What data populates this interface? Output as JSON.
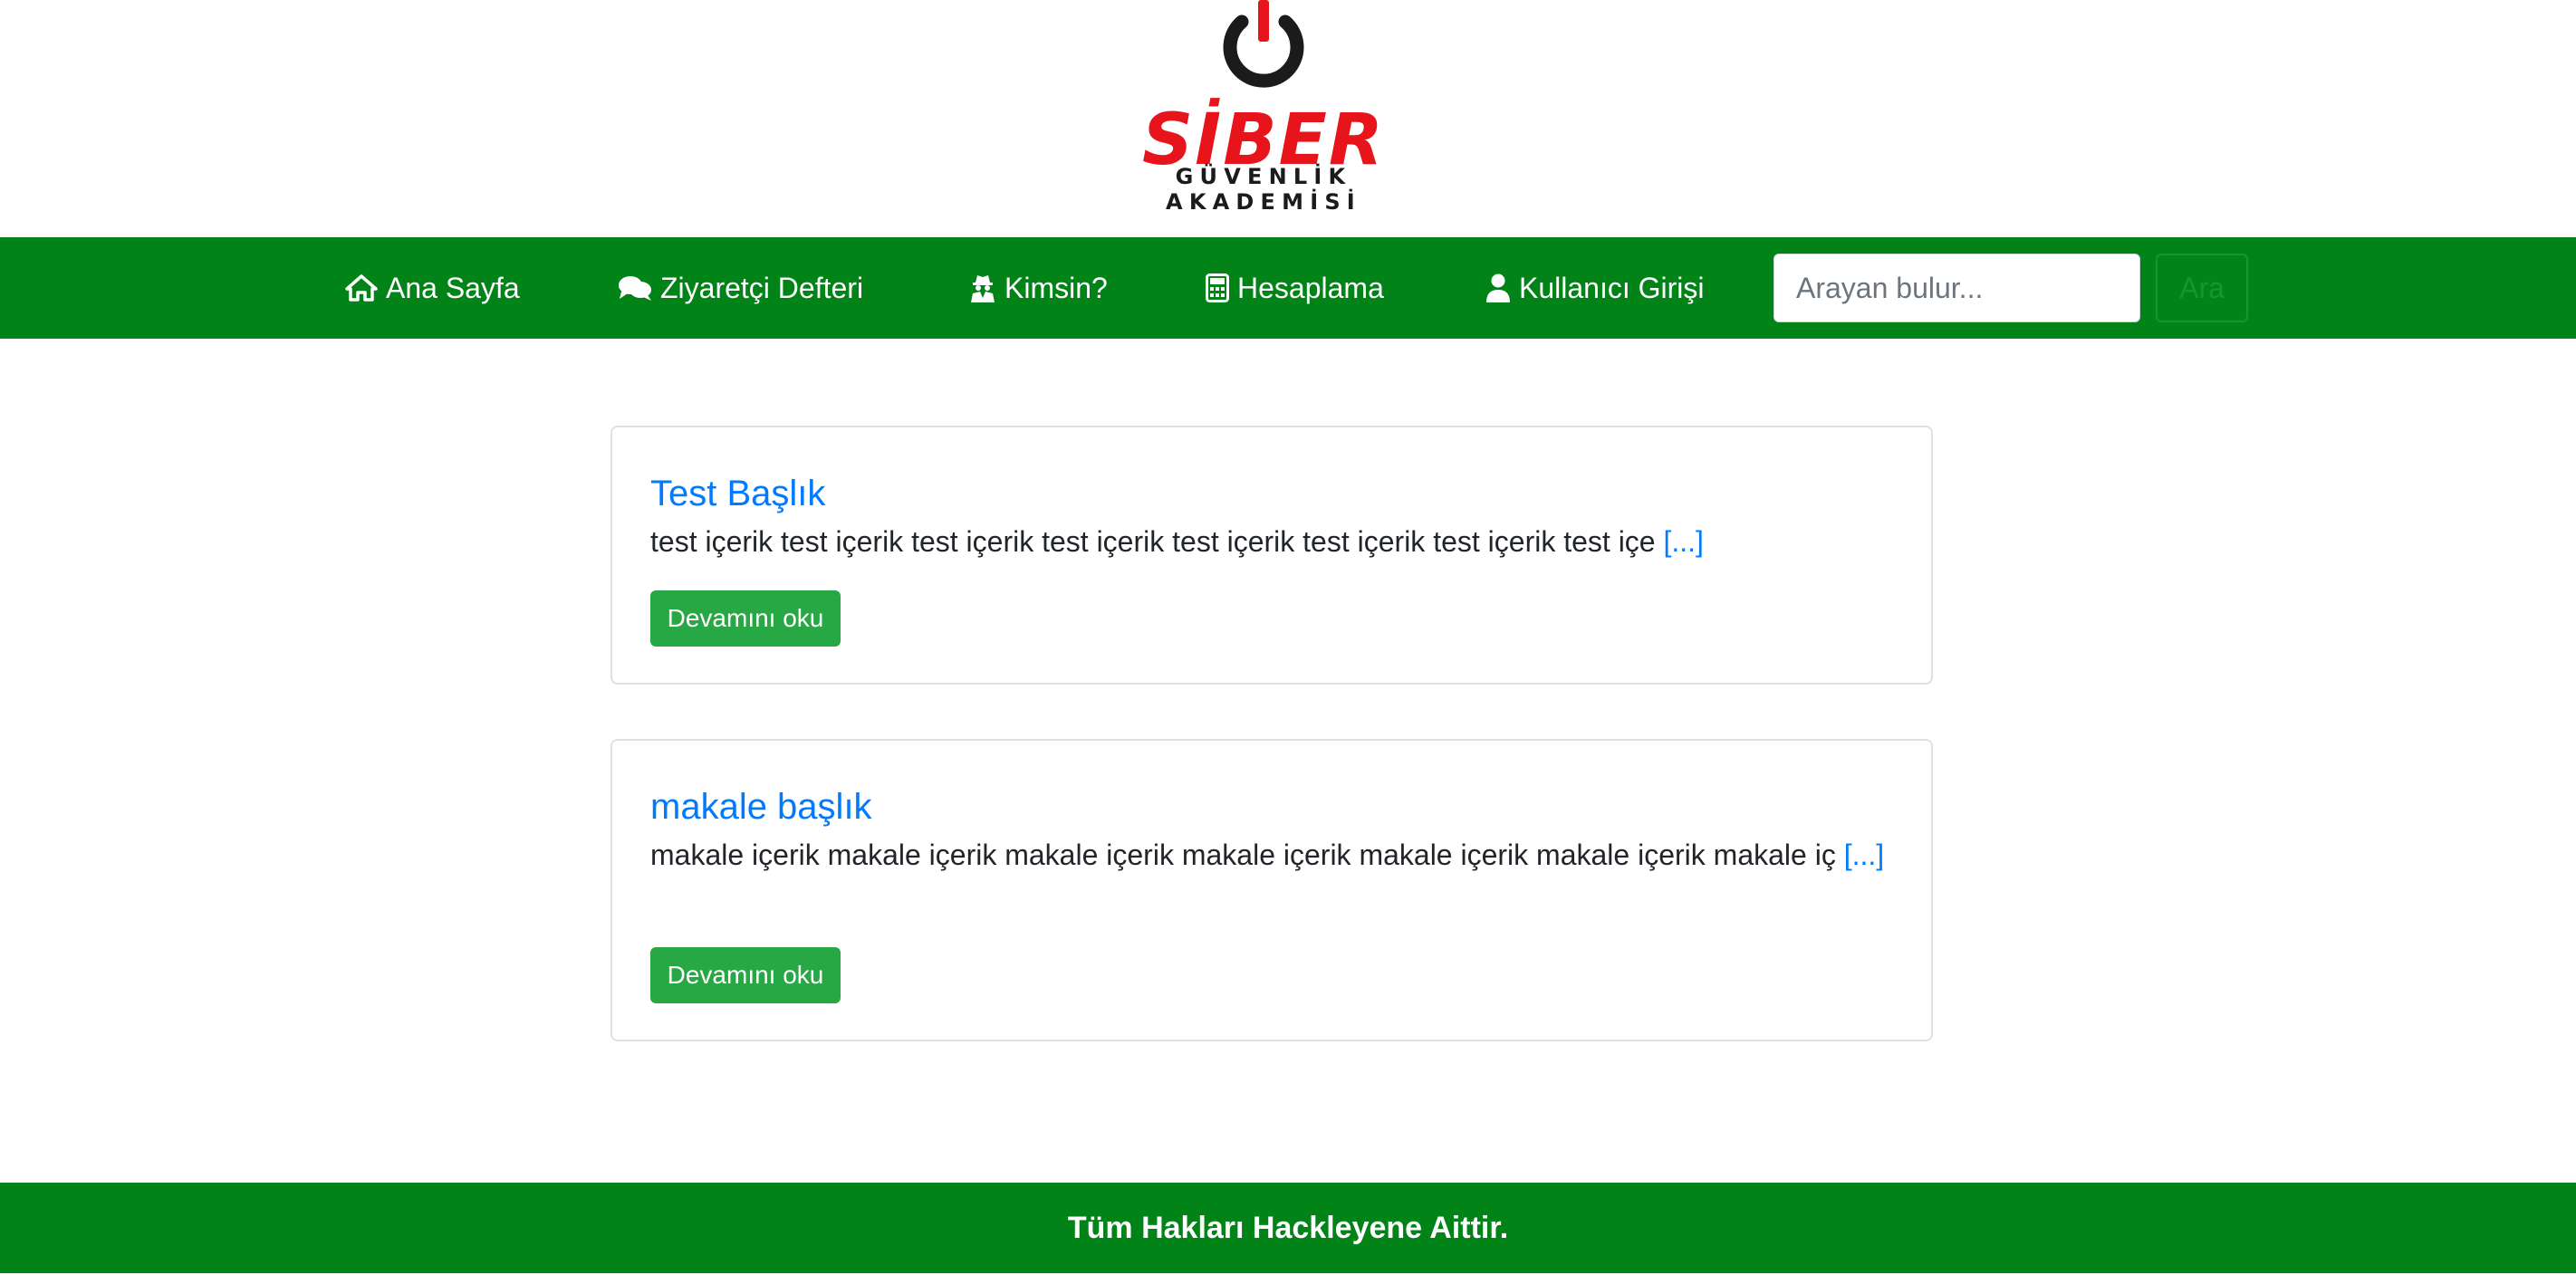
{
  "brand": {
    "name": "SİBER",
    "tagline": "GÜVENLİK AKADEMİSİ",
    "colors": {
      "red": "#e8141c",
      "dark": "#1b1b1b"
    },
    "icon": "power-icon"
  },
  "navbar": {
    "background": "#018318",
    "items": [
      {
        "label": "Ana Sayfa",
        "icon": "home-icon"
      },
      {
        "label": "Ziyaretçi Defteri",
        "icon": "comments-icon"
      },
      {
        "label": "Kimsin?",
        "icon": "user-secret-icon"
      },
      {
        "label": "Hesaplama",
        "icon": "calculator-icon"
      },
      {
        "label": "Kullanıcı Girişi",
        "icon": "user-icon"
      }
    ],
    "search": {
      "placeholder": "Arayan bulur...",
      "value": "",
      "button_label": "Ara"
    }
  },
  "articles": [
    {
      "title": "Test Başlık",
      "excerpt": "test içerik test içerik test içerik test içerik test içerik test içerik test içerik test içe",
      "more": "[...]",
      "button_label": "Devamını oku"
    },
    {
      "title": "makale başlık",
      "excerpt": "makale içerik makale içerik makale içerik makale içerik makale içerik makale içerik makale iç",
      "more": "[...]",
      "button_label": "Devamını oku"
    }
  ],
  "footer": {
    "text": "Tüm Hakları Hackleyene Aittir.",
    "background": "#018318"
  },
  "colors": {
    "link": "#007bff",
    "button": "#28a745"
  }
}
